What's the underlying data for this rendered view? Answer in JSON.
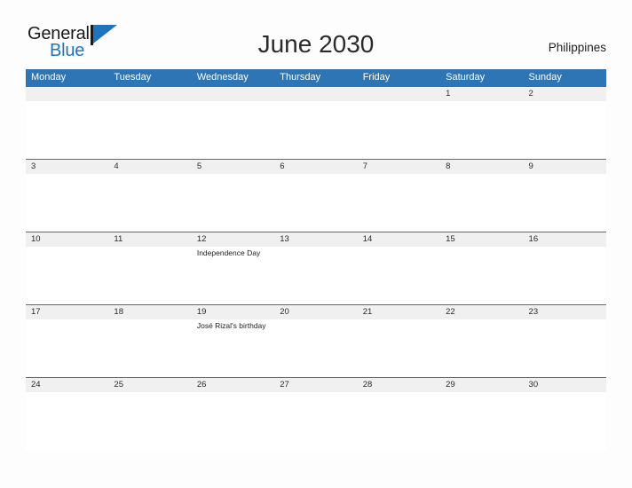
{
  "brand": {
    "name_part1": "General",
    "name_part2": "Blue",
    "flag_icon": "triangle-flag-icon",
    "accent_color": "#1f74bd"
  },
  "header": {
    "title": "June 2030",
    "country": "Philippines"
  },
  "theme": {
    "header_blue": "#2e75b6",
    "date_band_gray": "#f0f0f0",
    "page_background": "#fdfdfd",
    "text_color": "#2b2b2b"
  },
  "calendar": {
    "weekdays": [
      "Monday",
      "Tuesday",
      "Wednesday",
      "Thursday",
      "Friday",
      "Saturday",
      "Sunday"
    ],
    "weeks": [
      {
        "dates": [
          "",
          "",
          "",
          "",
          "",
          "1",
          "2"
        ],
        "events": [
          "",
          "",
          "",
          "",
          "",
          "",
          ""
        ]
      },
      {
        "dates": [
          "3",
          "4",
          "5",
          "6",
          "7",
          "8",
          "9"
        ],
        "events": [
          "",
          "",
          "",
          "",
          "",
          "",
          ""
        ]
      },
      {
        "dates": [
          "10",
          "11",
          "12",
          "13",
          "14",
          "15",
          "16"
        ],
        "events": [
          "",
          "",
          "Independence Day",
          "",
          "",
          "",
          ""
        ]
      },
      {
        "dates": [
          "17",
          "18",
          "19",
          "20",
          "21",
          "22",
          "23"
        ],
        "events": [
          "",
          "",
          "José Rizal's birthday",
          "",
          "",
          "",
          ""
        ]
      },
      {
        "dates": [
          "24",
          "25",
          "26",
          "27",
          "28",
          "29",
          "30"
        ],
        "events": [
          "",
          "",
          "",
          "",
          "",
          "",
          ""
        ]
      }
    ]
  }
}
